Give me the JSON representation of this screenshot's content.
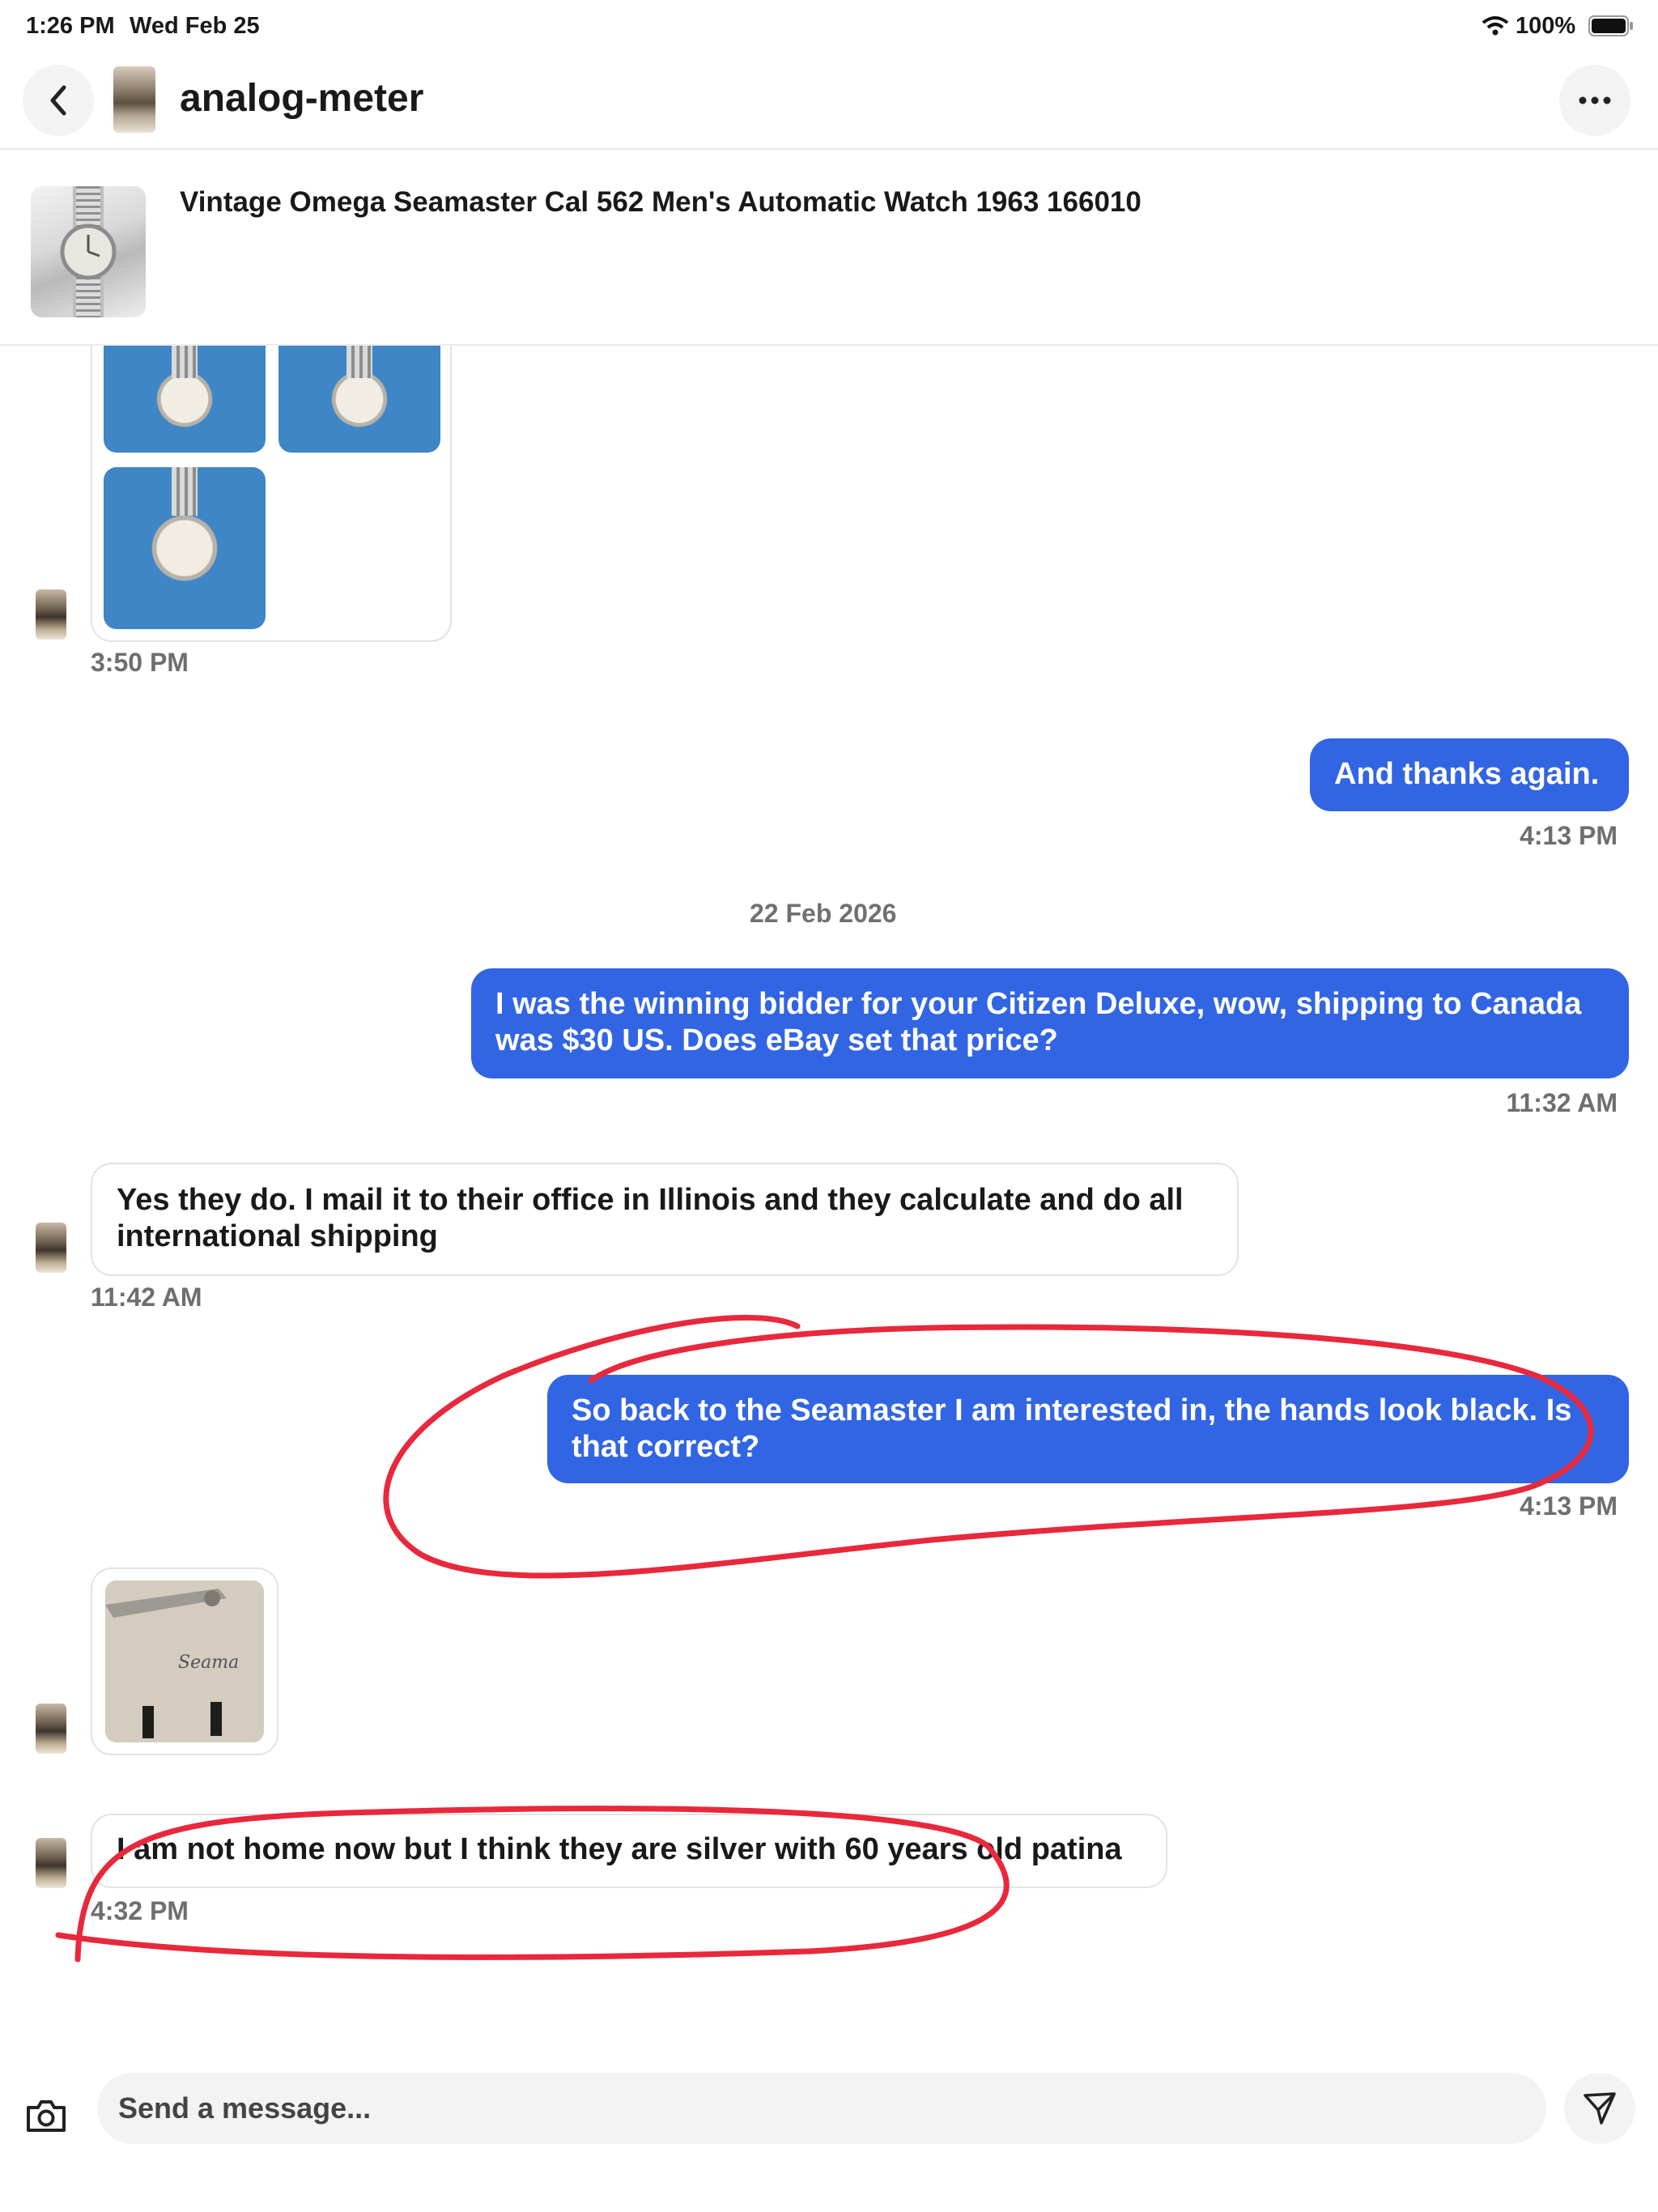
{
  "status_bar": {
    "time": "1:26 PM",
    "date": "Wed Feb 25",
    "battery": "100%"
  },
  "header": {
    "title": "analog-meter",
    "back_icon": "chevron-left-icon",
    "more_icon": "more-horizontal-icon"
  },
  "item": {
    "title": "Vintage Omega Seamaster  Cal 562 Men's Automatic Watch 1963 166010"
  },
  "messages": {
    "m1_time": "3:50 PM",
    "m2_text": "And thanks again.",
    "m2_time": "4:13 PM",
    "date_separator": "22 Feb 2026",
    "m3_line1": "I was the winning bidder for your Citizen Deluxe, wow, shipping to Canada",
    "m3_line2": "was $30 US. Does eBay set that price?",
    "m3_time": "11:32 AM",
    "m4_line1": "Yes they do. I mail it to their office in Illinois and they calculate and do all",
    "m4_line2": "international shipping",
    "m4_time": "11:42 AM",
    "m5_line1": "So back to the Seamaster I am interested in, the hands look black. Is",
    "m5_line2": "that correct?",
    "m5_time": "4:13 PM",
    "m7_text": "I am not home now but I think they are silver with 60 years old patina",
    "m7_time": "4:32 PM"
  },
  "photo_dial_text": "Seama",
  "composer": {
    "placeholder": "Send a message...",
    "camera_icon": "camera-icon",
    "send_icon": "send-icon"
  },
  "colors": {
    "outgoing_bubble": "#3265e3",
    "annotation": "#e8283c"
  }
}
